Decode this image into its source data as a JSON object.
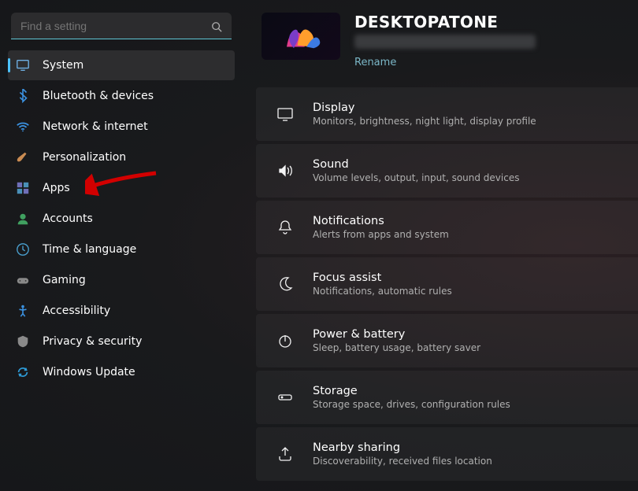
{
  "search": {
    "placeholder": "Find a setting"
  },
  "sidebar": {
    "items": [
      {
        "label": "System"
      },
      {
        "label": "Bluetooth & devices"
      },
      {
        "label": "Network & internet"
      },
      {
        "label": "Personalization"
      },
      {
        "label": "Apps"
      },
      {
        "label": "Accounts"
      },
      {
        "label": "Time & language"
      },
      {
        "label": "Gaming"
      },
      {
        "label": "Accessibility"
      },
      {
        "label": "Privacy & security"
      },
      {
        "label": "Windows Update"
      }
    ]
  },
  "header": {
    "device_name": "DESKTOPATONE",
    "rename": "Rename"
  },
  "cards": [
    {
      "title": "Display",
      "sub": "Monitors, brightness, night light, display profile"
    },
    {
      "title": "Sound",
      "sub": "Volume levels, output, input, sound devices"
    },
    {
      "title": "Notifications",
      "sub": "Alerts from apps and system"
    },
    {
      "title": "Focus assist",
      "sub": "Notifications, automatic rules"
    },
    {
      "title": "Power & battery",
      "sub": "Sleep, battery usage, battery saver"
    },
    {
      "title": "Storage",
      "sub": "Storage space, drives, configuration rules"
    },
    {
      "title": "Nearby sharing",
      "sub": "Discoverability, received files location"
    }
  ]
}
